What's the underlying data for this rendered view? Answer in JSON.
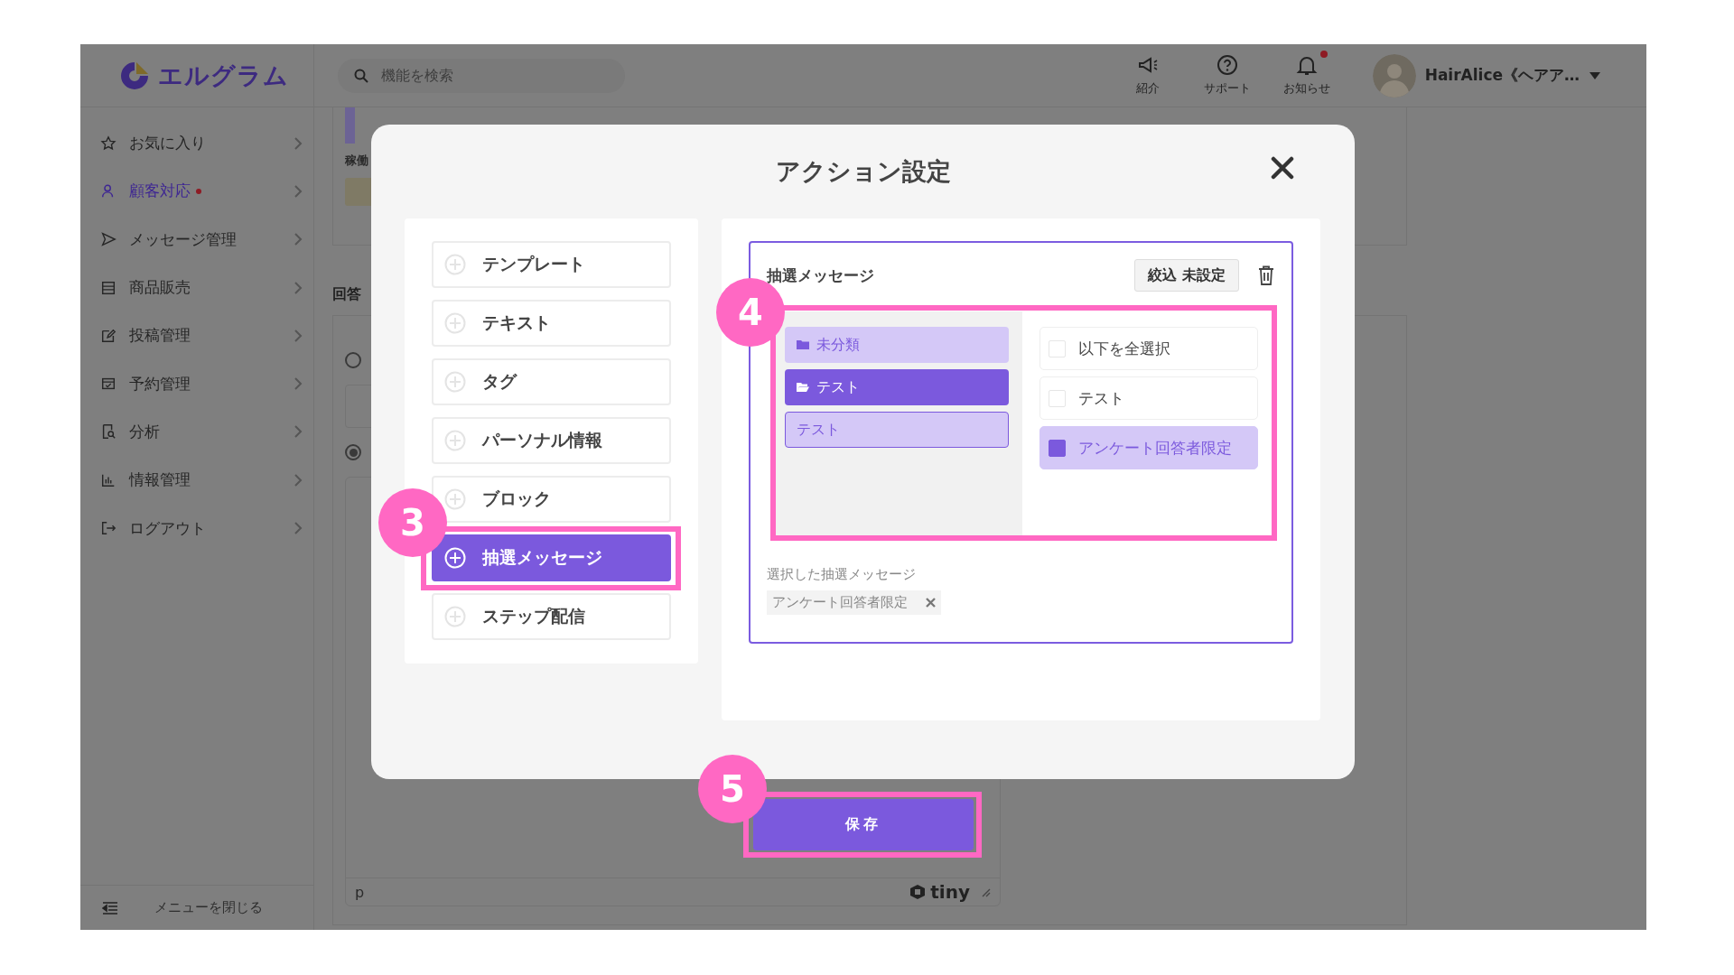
{
  "header": {
    "logo": "エルグラム",
    "search": {
      "placeholder": "機能を検索"
    },
    "icons": [
      {
        "label": "紹介",
        "badge": false
      },
      {
        "label": "サポート",
        "badge": false
      },
      {
        "label": "お知らせ",
        "badge": true
      }
    ],
    "user": {
      "name": "HairAlice《ヘアア…"
    }
  },
  "sidebar": {
    "items": [
      {
        "label": "お気に入り",
        "selected": false,
        "alert": false
      },
      {
        "label": "顧客対応",
        "selected": true,
        "alert": true
      },
      {
        "label": "メッセージ管理",
        "selected": false,
        "alert": false
      },
      {
        "label": "商品販売",
        "selected": false,
        "alert": false
      },
      {
        "label": "投稿管理",
        "selected": false,
        "alert": false
      },
      {
        "label": "予約管理",
        "selected": false,
        "alert": false
      },
      {
        "label": "分析",
        "selected": false,
        "alert": false
      },
      {
        "label": "情報管理",
        "selected": false,
        "alert": false
      },
      {
        "label": "ログアウト",
        "selected": false,
        "alert": false
      }
    ],
    "collapse": "メニューを閉じる"
  },
  "background": {
    "status_label": "稼働",
    "section_label": "回答",
    "radios": [
      {
        "checked": false
      },
      {
        "checked": true
      }
    ],
    "editor": {
      "path": "p",
      "brand": "tiny"
    },
    "save_button": "保存"
  },
  "modal": {
    "title": "アクション設定",
    "actions": [
      {
        "label": "テンプレート",
        "selected": false
      },
      {
        "label": "テキスト",
        "selected": false
      },
      {
        "label": "タグ",
        "selected": false
      },
      {
        "label": "パーソナル情報",
        "selected": false
      },
      {
        "label": "ブロック",
        "selected": false
      },
      {
        "label": "抽選メッセージ",
        "selected": true
      },
      {
        "label": "ステップ配信",
        "selected": false
      }
    ],
    "lottery": {
      "title": "抽選メッセージ",
      "filter": "絞込 未設定",
      "folders": [
        {
          "label": "未分類",
          "kind": "folder",
          "selected": false
        },
        {
          "label": "テスト",
          "kind": "folder",
          "selected": true
        },
        {
          "label": "テスト",
          "kind": "item",
          "selected": false
        }
      ],
      "options": [
        {
          "label": "以下を全選択",
          "checked": false
        },
        {
          "label": "テスト",
          "checked": false
        },
        {
          "label": "アンケート回答者限定",
          "checked": true
        }
      ],
      "selected_label": "選択した抽選メッセージ",
      "chips": [
        {
          "label": "アンケート回答者限定"
        }
      ]
    }
  },
  "annotations": [
    {
      "label": "3"
    },
    {
      "label": "4"
    },
    {
      "label": "5"
    }
  ]
}
